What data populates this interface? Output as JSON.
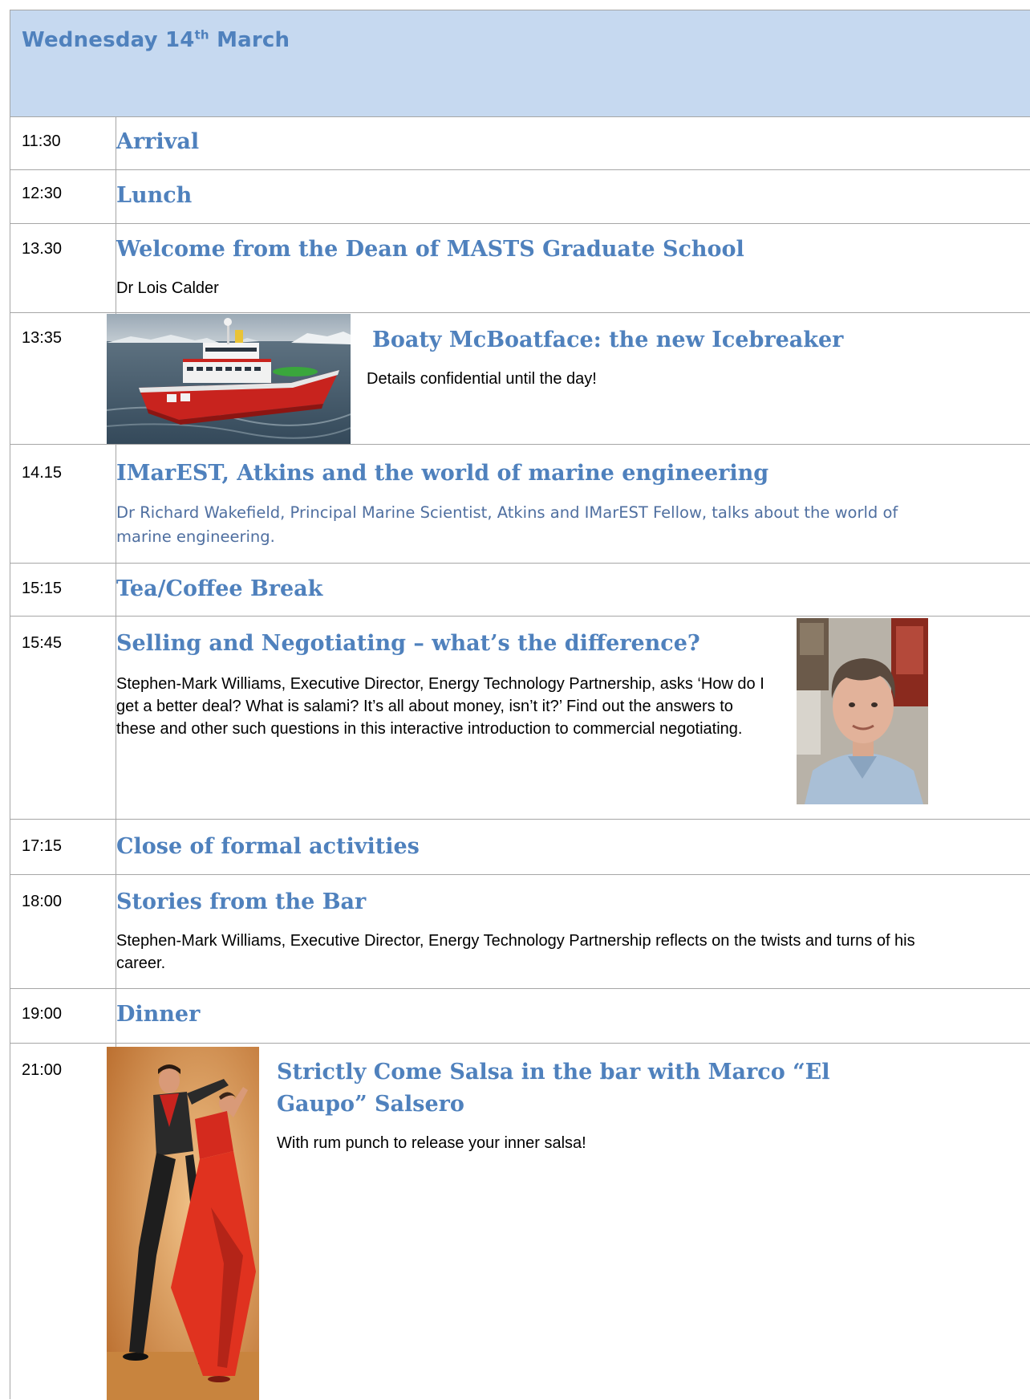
{
  "header": {
    "day": "Wednesday 14",
    "day_suffix": "th",
    "month": " March"
  },
  "colors": {
    "header_bg": "#c6d9f0",
    "title_blue": "#4f81bd",
    "border": "#a6a6a6"
  },
  "sessions": [
    {
      "time": "11:30",
      "title": "Arrival"
    },
    {
      "time": "12:30",
      "title": "Lunch"
    },
    {
      "time": "13.30",
      "title": "Welcome from the Dean of MASTS Graduate School",
      "desc": "Dr Lois Calder"
    },
    {
      "time": "13:35",
      "title": "Boaty McBoatface: the new Icebreaker",
      "desc": "Details confidential until the day!",
      "image": "ship-illustration"
    },
    {
      "time": "14.15",
      "title": "IMarEST, Atkins and the world of marine engineering",
      "desc": "Dr Richard Wakefield, Principal Marine Scientist, Atkins and IMarEST Fellow, talks about the world of marine engineering."
    },
    {
      "time": "15:15",
      "title": "Tea/Coffee Break"
    },
    {
      "time": "15:45",
      "title": "Selling and Negotiating – what’s the difference?",
      "desc": "Stephen-Mark Williams, Executive Director, Energy Technology Partnership, asks ‘How do I get a better deal? What is salami? It’s all about money, isn’t it?’ Find out the answers to these and other such questions in this interactive introduction to commercial negotiating.",
      "image": "speaker-portrait"
    },
    {
      "time": "17:15",
      "title": "Close of formal activities"
    },
    {
      "time": "18:00",
      "title": "Stories from the Bar",
      "desc": "Stephen-Mark Williams, Executive Director, Energy Technology Partnership reflects on the twists and turns of his career."
    },
    {
      "time": "19:00",
      "title": "Dinner"
    },
    {
      "time": "21:00",
      "title": "Strictly Come Salsa in the bar with Marco “El Gaupo” Salsero",
      "desc": "With rum punch to release your inner salsa!",
      "image": "salsa-dancers-photo"
    }
  ]
}
